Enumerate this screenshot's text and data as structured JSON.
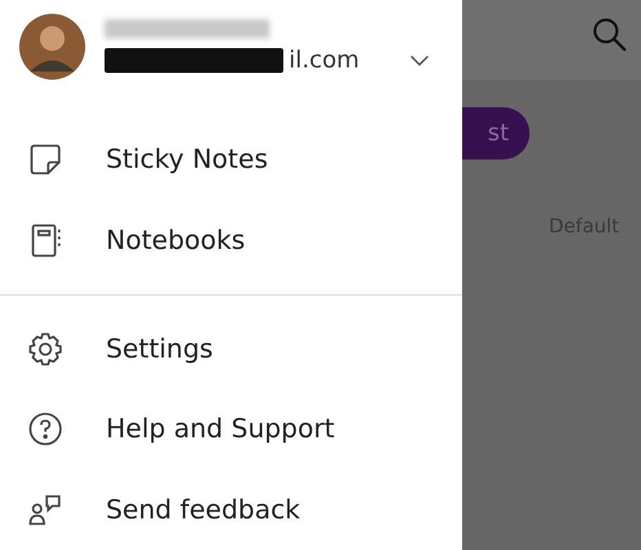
{
  "drawer": {
    "account": {
      "email": "il.com"
    },
    "menu_groups": [
      [
        {
          "label": "Sticky Notes"
        },
        {
          "label": "Notebooks"
        }
      ],
      [
        {
          "label": "Settings"
        },
        {
          "label": "Help and Support"
        },
        {
          "label": "Send feedback"
        }
      ]
    ]
  },
  "background": {
    "button_label": "st",
    "label": "Default"
  }
}
